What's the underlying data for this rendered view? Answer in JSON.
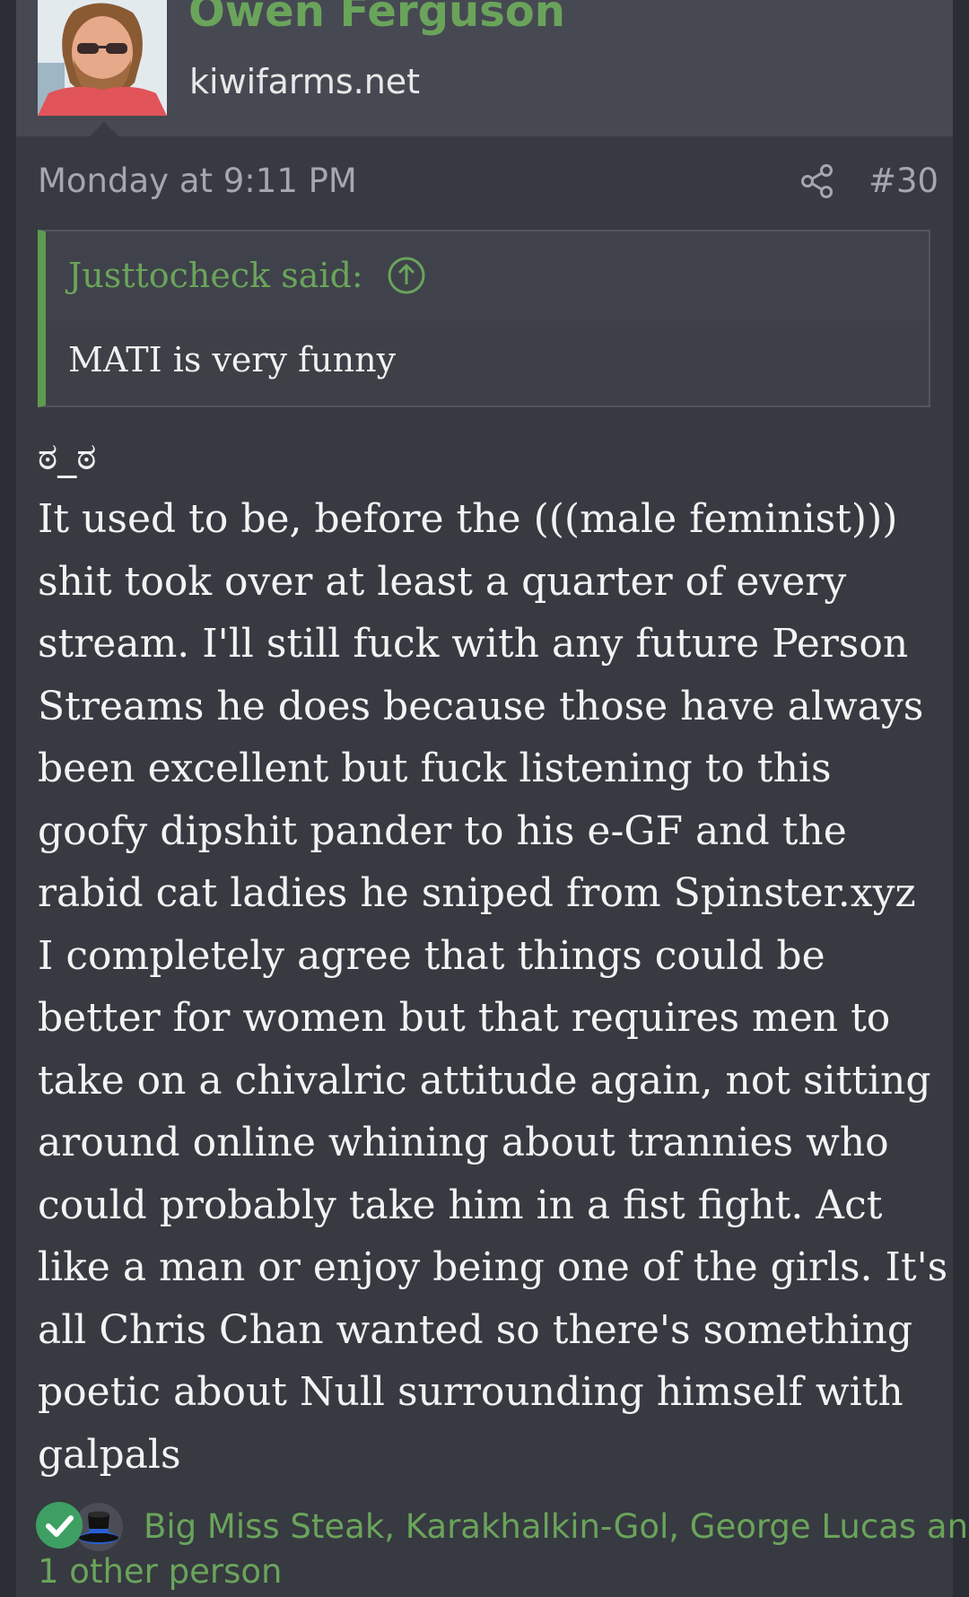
{
  "post": {
    "username": "Owen Ferguson",
    "user_title": "kiwifarms.net",
    "date": "Monday at 9:11 PM",
    "post_number": "#30",
    "quote": {
      "author": "Justtocheck said:",
      "text": "MATI is very funny"
    },
    "emoticon": "ಠ_ಠ",
    "body_lines": [
      "It used to be, before the (((male feminist)))",
      "shit took over at least a quarter of every",
      "stream. I'll still fuck with any future Person",
      "Streams he does because those have always",
      "been excellent but fuck listening to this",
      "goofy dipshit pander to his e-GF and the",
      "rabid cat ladies he sniped from Spinster.xyz",
      "I completely agree that things could be",
      "better for women but that requires men to",
      "take on a chivalric attitude again, not sitting",
      "around online whining about trannies who",
      "could probably take him in a fist fight. Act",
      "like a man or enjoy being one of the girls. It's",
      "all Chris Chan wanted so there's something",
      "poetic about Null surrounding himself with",
      "galpals"
    ],
    "reactions": {
      "line1": "Big Miss Steak, Karakhalkin-Gol, George Lucas and",
      "line2": "1 other person",
      "icons": [
        "check-icon",
        "top-hat-icon"
      ]
    }
  },
  "colors": {
    "page_background": "#2b2e34",
    "post_background": "#373a41",
    "header_background": "#464952",
    "accent_green": "#6aa45b",
    "quote_border": "#5f9b4f",
    "meta_text": "#a4a7ad",
    "body_text": "#f3f3f3"
  }
}
